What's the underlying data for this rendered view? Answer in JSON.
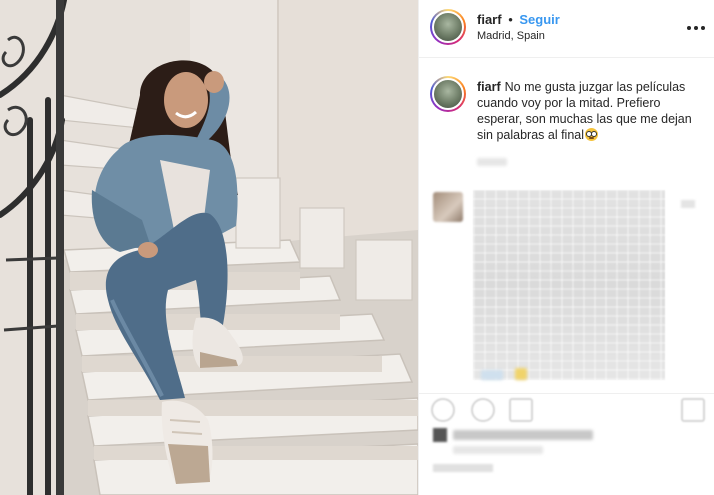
{
  "post": {
    "username": "fiarf",
    "separator": "•",
    "follow_label": "Seguir",
    "location": "Madrid, Spain",
    "more_options_icon": "more-horizontal-icon"
  },
  "caption": {
    "username": "fiarf",
    "text": "No me gusta juzgar las películas cuando voy por la mitad. Prefiero esperar, son muchas las que me dejan sin palabras al final",
    "emoji_icon": "astonished-face-emoji"
  },
  "colors": {
    "follow_blue": "#3897f0",
    "text": "#262626",
    "divider": "#efefef"
  }
}
